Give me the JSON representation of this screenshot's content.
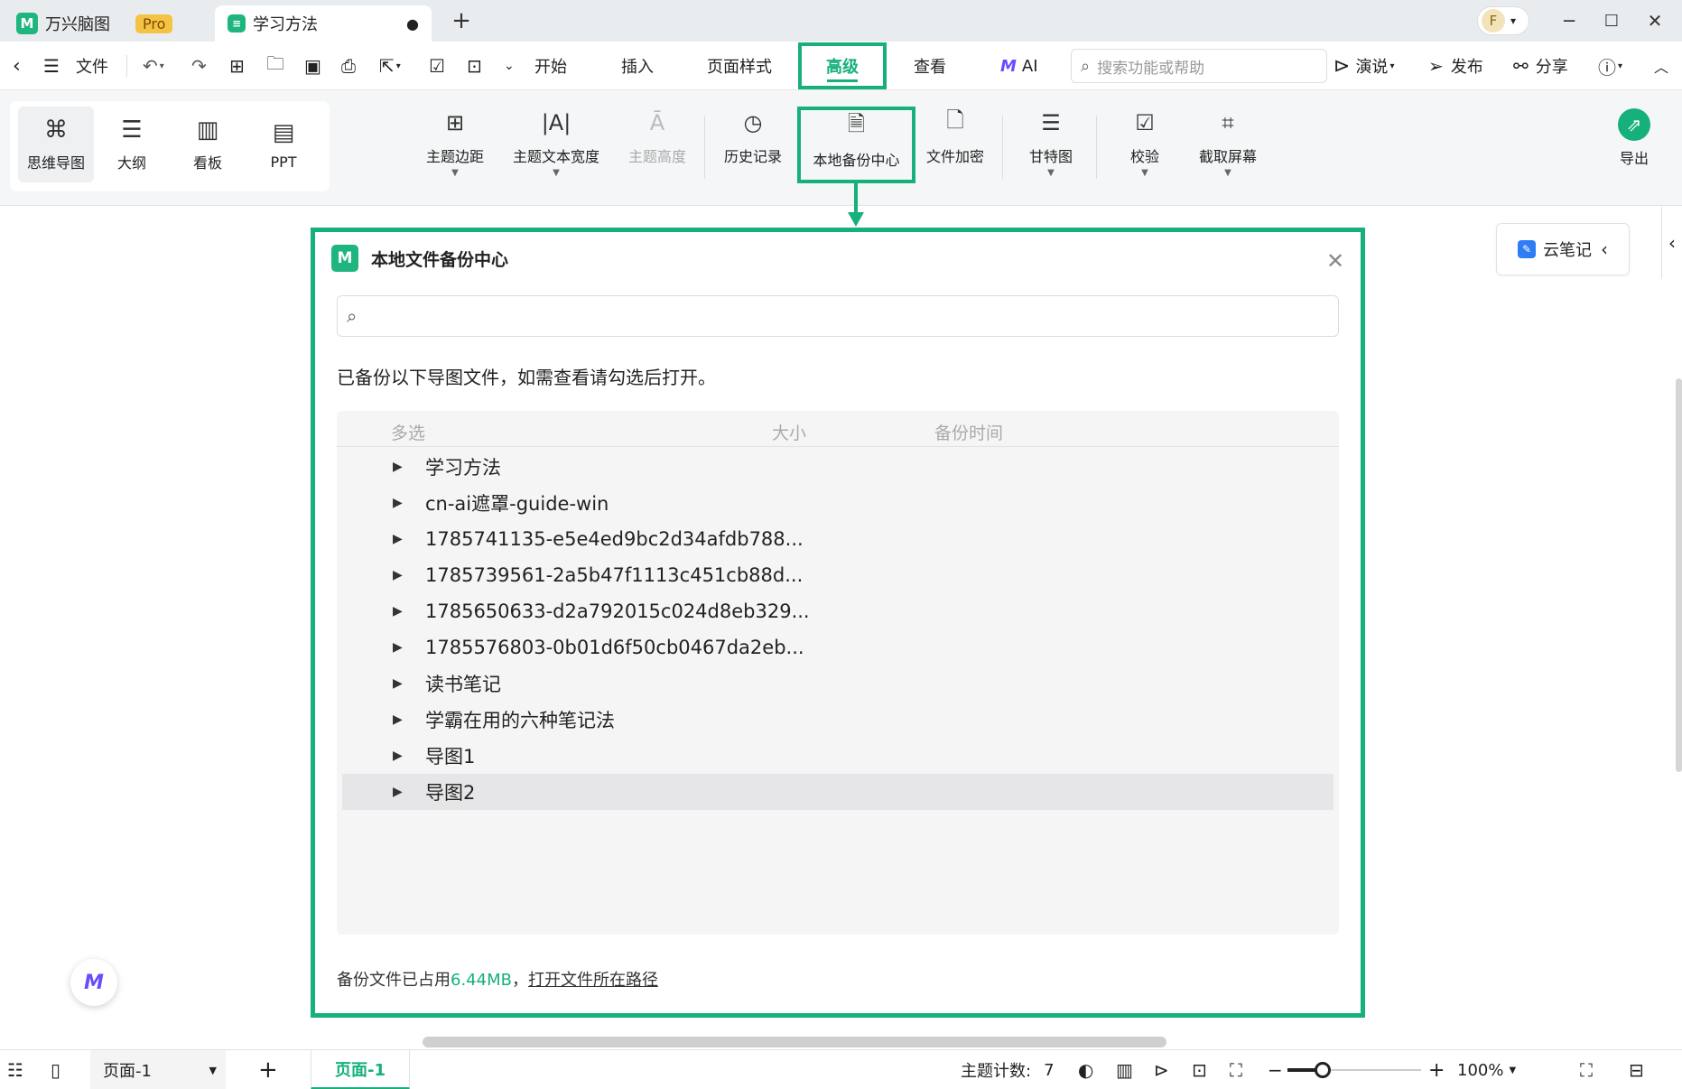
{
  "titlebar": {
    "app_name": "万兴脑图",
    "pro_badge": "Pro",
    "doc_tab": "学习方法",
    "new_tab": "+",
    "avatar_letter": "F"
  },
  "menubar": {
    "file": "文件",
    "tabs": [
      "开始",
      "插入",
      "页面样式",
      "高级",
      "查看"
    ],
    "ai": "AI",
    "search_placeholder": "搜索功能或帮助",
    "present": "演说",
    "publish": "发布",
    "share": "分享"
  },
  "views": [
    "思维导图",
    "大纲",
    "看板",
    "PPT"
  ],
  "ribbon": {
    "items": [
      "主题边距",
      "主题文本宽度",
      "主题高度",
      "历史记录",
      "本地备份中心",
      "文件加密",
      "甘特图",
      "校验",
      "截取屏幕"
    ],
    "export": "导出"
  },
  "side": {
    "cloud_note": "云笔记"
  },
  "dialog": {
    "title": "本地文件备份中心",
    "instruction": "已备份以下导图文件，如需查看请勾选后打开。",
    "columns": [
      "多选",
      "大小",
      "备份时间"
    ],
    "rows": [
      "学习方法",
      "cn-ai遮罩-guide-win",
      "1785741135-e5e4ed9bc2d34afdb788...",
      "1785739561-2a5b47f1113c451cb88d...",
      "1785650633-d2a792015c024d8eb329...",
      "1785576803-0b01d6f50cb0467da2eb...",
      "读书笔记",
      "学霸在用的六种笔记法",
      "导图1",
      "导图2"
    ],
    "footer_prefix": "备份文件已占用",
    "footer_size": "6.44MB",
    "footer_comma": "，",
    "footer_link": "打开文件所在路径"
  },
  "statusbar": {
    "page_select": "页面-1",
    "page_tab": "页面-1",
    "topic_count_label": "主题计数:",
    "topic_count": "7",
    "zoom": "100%"
  },
  "colors": {
    "accent": "#16b07a",
    "pro": "#f5c343"
  }
}
